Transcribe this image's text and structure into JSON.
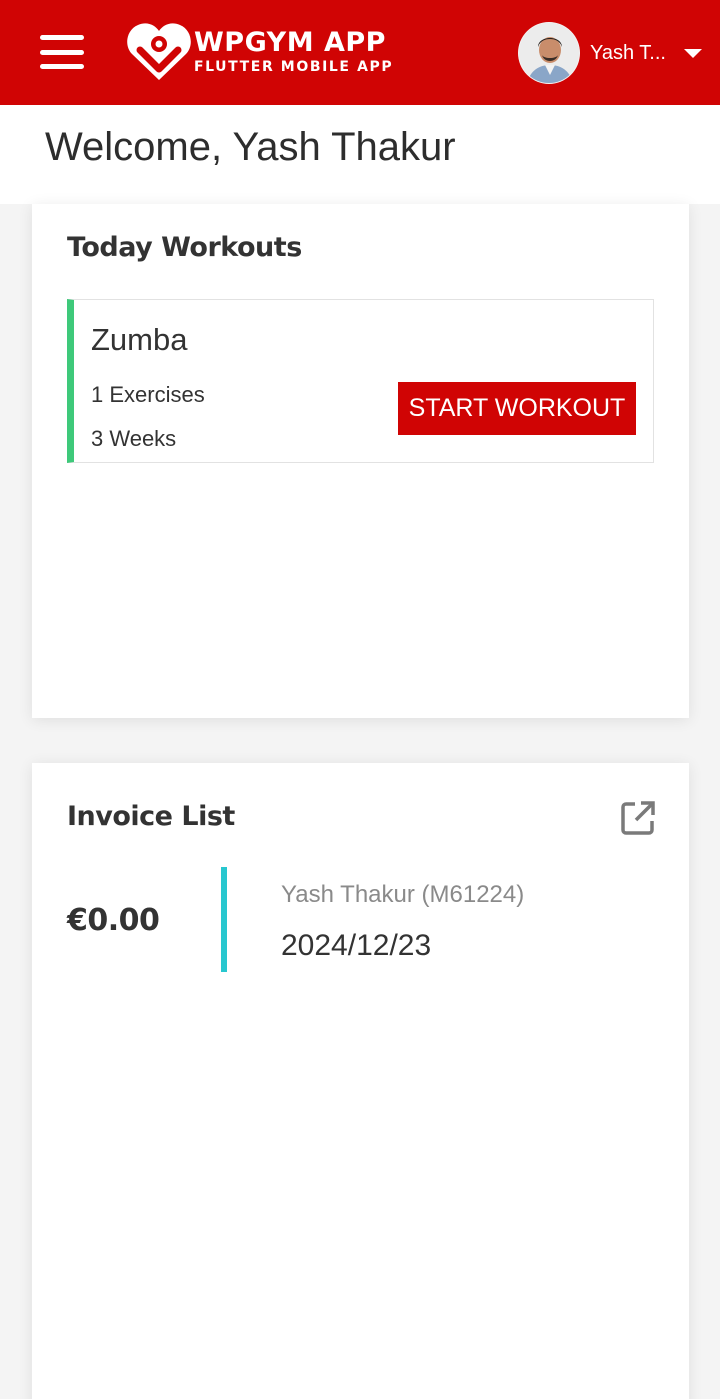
{
  "header": {
    "menu_icon": "hamburger-menu-icon",
    "logo_title": "WPGYM APP",
    "logo_subtitle": "FLUTTER MOBILE APP",
    "user_name": "Yash T...",
    "dropdown_icon": "caret-down-icon",
    "brand_color": "#d00404"
  },
  "welcome": {
    "text": "Welcome, Yash Thakur"
  },
  "today_workouts": {
    "title": "Today Workouts",
    "items": [
      {
        "name": "Zumba",
        "exercises": "1 Exercises",
        "weeks": "3 Weeks",
        "button_label": "START WORKOUT",
        "accent_color": "#3ec97a"
      }
    ]
  },
  "invoice_list": {
    "title": "Invoice List",
    "open_icon": "open-in-new-icon",
    "items": [
      {
        "amount": "€0.00",
        "member": "Yash Thakur (M61224)",
        "date": "2024/12/23",
        "accent_color": "#28c7cf"
      }
    ]
  }
}
